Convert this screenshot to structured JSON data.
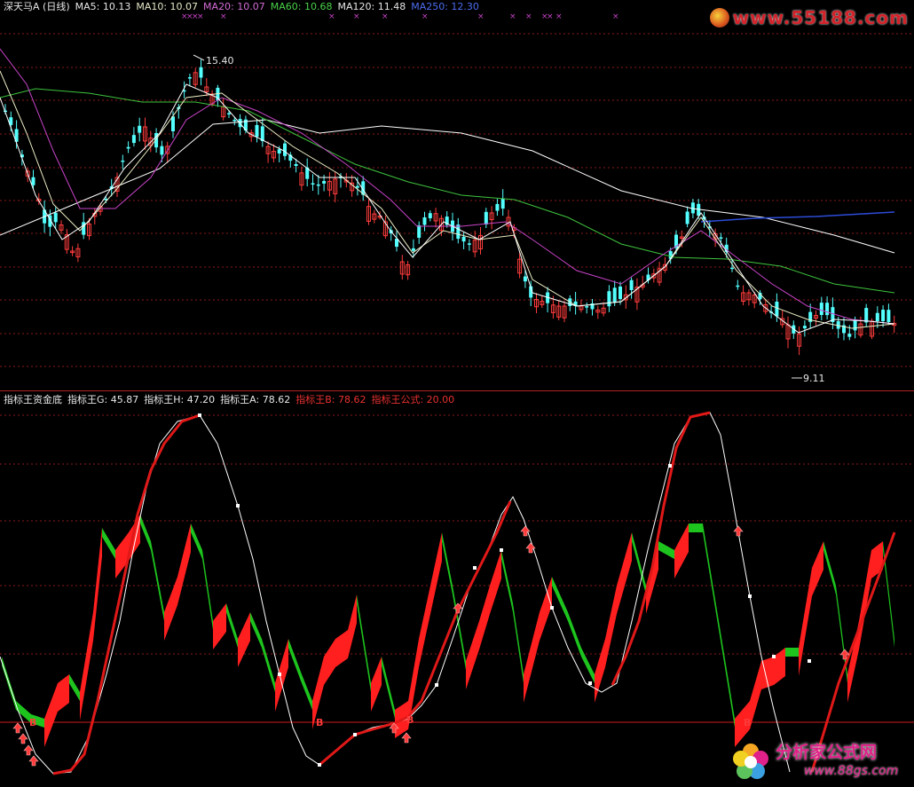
{
  "price_legend": [
    {
      "text": "深天马A (日线)",
      "color": "#e6e6e6"
    },
    {
      "text": "MA5: 10.13",
      "color": "#e6e6e6"
    },
    {
      "text": "MA10: 10.07",
      "color": "#e6e6c8"
    },
    {
      "text": "MA20: 10.07",
      "color": "#d36ad6"
    },
    {
      "text": "MA60: 10.68",
      "color": "#49d149"
    },
    {
      "text": "MA120: 11.48",
      "color": "#e6e6e6"
    },
    {
      "text": "MA250: 12.30",
      "color": "#4c6cf0"
    }
  ],
  "indicator_legend": [
    {
      "text": "指标王资金底",
      "color": "#e6e6e6"
    },
    {
      "text": "指标王G: 45.87",
      "color": "#e6e6e6"
    },
    {
      "text": "指标王H: 47.20",
      "color": "#e6e6e6"
    },
    {
      "text": "指标王A: 78.62",
      "color": "#e6e6e6"
    },
    {
      "text": "指标王B: 78.62",
      "color": "#e8312f"
    },
    {
      "text": "指标王公式: 20.00",
      "color": "#e8312f"
    }
  ],
  "price_annotations": {
    "high": "15.40",
    "low": "9.11"
  },
  "buy_marker_label": "B",
  "colors": {
    "up": "#ff3c3c",
    "down": "#54ffff",
    "grid": "#8b1a1a",
    "ma5": "#ffffff",
    "ma10": "#f0f0c8",
    "ma20": "#c844c8",
    "ma60": "#3ec43e",
    "ma120": "#ffffff",
    "ma250": "#2c4cd8",
    "band_up": "#ff1f1f",
    "band_down": "#1ec41e",
    "curve_red": "#e01818",
    "curve_white": "#ffffff"
  },
  "watermarks": {
    "top": "www.55188.com",
    "bottom_cn": "分析家公式网",
    "bottom_url": "www.88gs.com"
  }
}
